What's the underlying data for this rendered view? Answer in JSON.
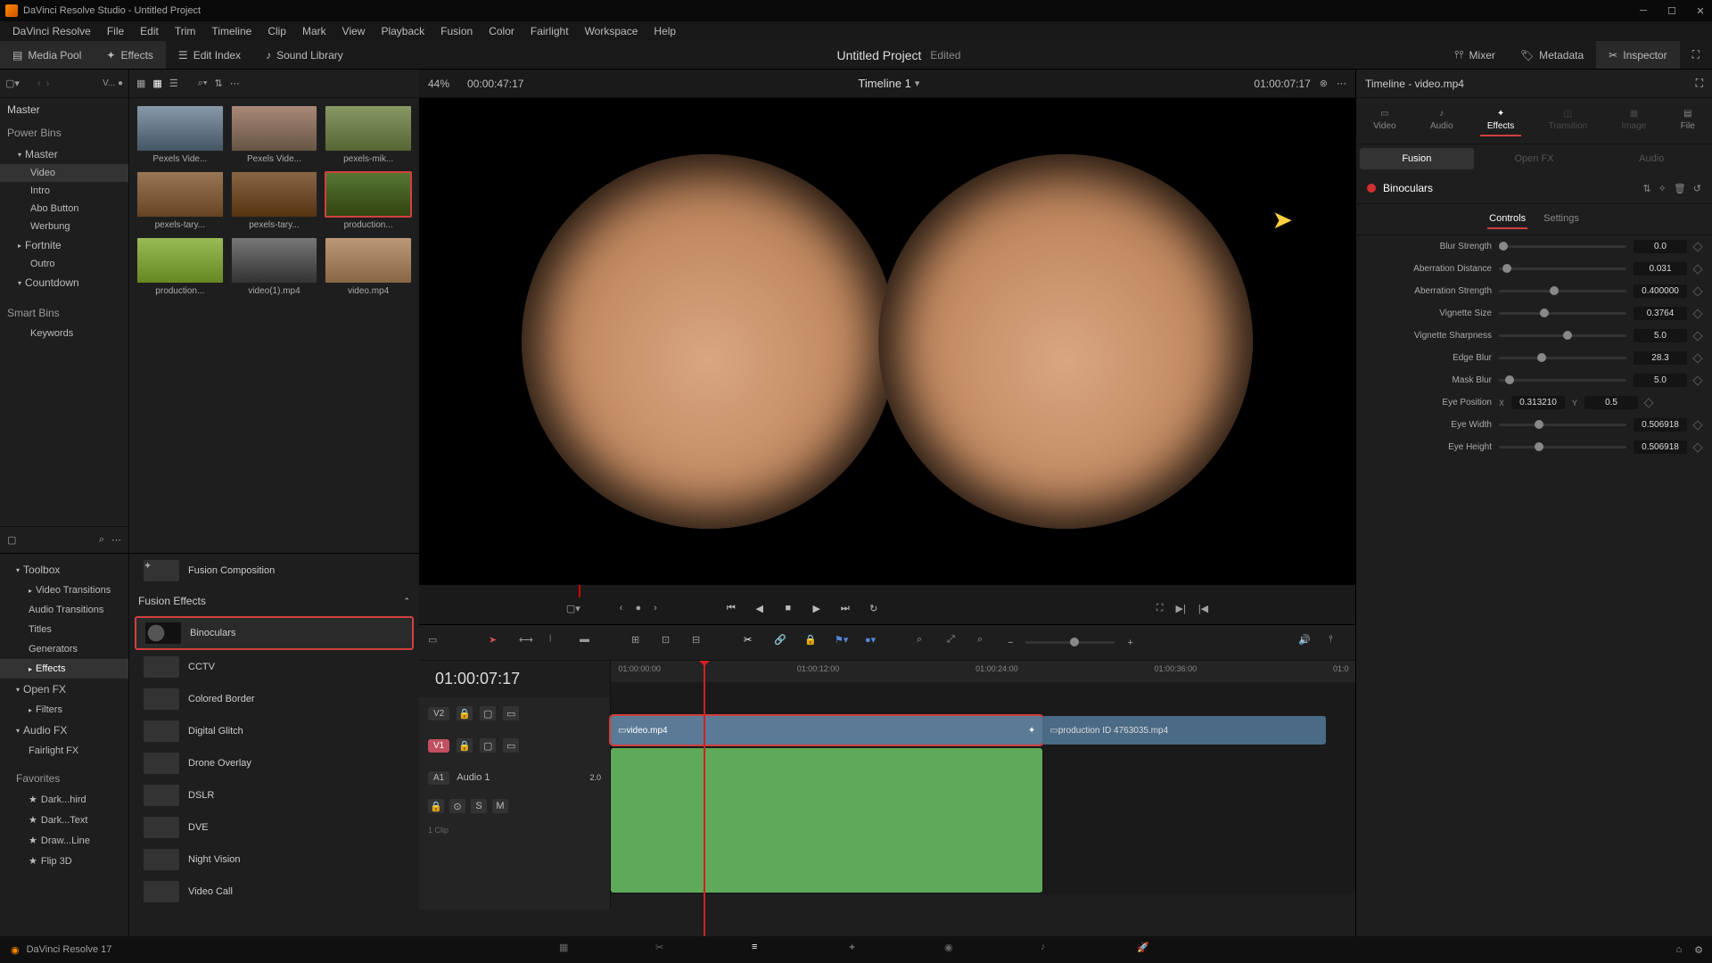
{
  "title": "DaVinci Resolve Studio - Untitled Project",
  "menus": [
    "DaVinci Resolve",
    "File",
    "Edit",
    "Trim",
    "Timeline",
    "Clip",
    "Mark",
    "View",
    "Playback",
    "Fusion",
    "Color",
    "Fairlight",
    "Workspace",
    "Help"
  ],
  "workspace": {
    "buttons": [
      "Media Pool",
      "Effects",
      "Edit Index",
      "Sound Library"
    ],
    "right": [
      "Mixer",
      "Metadata",
      "Inspector"
    ],
    "project": "Untitled Project",
    "edited": "Edited"
  },
  "bins": {
    "master": "Master",
    "power_header": "Power Bins",
    "items": [
      "Master",
      "Video",
      "Intro",
      "Abo Button",
      "Werbung",
      "Fortnite",
      "Outro",
      "Countdown"
    ],
    "smart_header": "Smart Bins",
    "smart_items": [
      "Keywords"
    ]
  },
  "clips": [
    {
      "name": "Pexels Vide..."
    },
    {
      "name": "Pexels Vide..."
    },
    {
      "name": "pexels-mik..."
    },
    {
      "name": "pexels-tary..."
    },
    {
      "name": "pexels-tary..."
    },
    {
      "name": "production..."
    },
    {
      "name": "production..."
    },
    {
      "name": "video(1).mp4"
    },
    {
      "name": "video.mp4"
    }
  ],
  "fx_tree": {
    "toolbox": "Toolbox",
    "items": [
      "Video Transitions",
      "Audio Transitions",
      "Titles",
      "Generators",
      "Effects"
    ],
    "openfx": "Open FX",
    "filters": "Filters",
    "audiofx": "Audio FX",
    "fairlight": "Fairlight FX",
    "fav": "Favorites",
    "favs": [
      "Dark...hird",
      "Dark...Text",
      "Draw...Line",
      "Flip 3D"
    ]
  },
  "fx_list": {
    "fusion_comp": "Fusion Composition",
    "header": "Fusion Effects",
    "items": [
      "Binoculars",
      "CCTV",
      "Colored Border",
      "Digital Glitch",
      "Drone Overlay",
      "DSLR",
      "DVE",
      "Night Vision",
      "Video Call"
    ]
  },
  "viewer": {
    "zoom": "44%",
    "idle_tc": "00:00:47:17",
    "title": "Timeline 1",
    "right_tc": "01:00:07:17"
  },
  "timeline": {
    "tc": "01:00:07:17",
    "ticks": [
      "01:00:00:00",
      "01:00:12:00",
      "01:00:24:00",
      "01:00:36:00",
      "01:0"
    ],
    "v2": "V2",
    "v1": "V1",
    "a1": "A1",
    "a1_name": "Audio 1",
    "a1_gain": "2.0",
    "a1_sub": "1 Clip",
    "clip1": "video.mp4",
    "clip2": "production ID 4763035.mp4"
  },
  "inspector": {
    "header": "Timeline - video.mp4",
    "tabs": [
      "Video",
      "Audio",
      "Effects",
      "Transition",
      "Image",
      "File"
    ],
    "subtabs": [
      "Fusion",
      "Open FX",
      "Audio"
    ],
    "fx_name": "Binoculars",
    "param_tabs": [
      "Controls",
      "Settings"
    ],
    "params": [
      {
        "label": "Blur Strength",
        "val": "0.0",
        "pos": 0
      },
      {
        "label": "Aberration Distance",
        "val": "0.031",
        "pos": 3
      },
      {
        "label": "Aberration Strength",
        "val": "0.400000",
        "pos": 40
      },
      {
        "label": "Vignette Size",
        "val": "0.3764",
        "pos": 32
      },
      {
        "label": "Vignette Sharpness",
        "val": "5.0",
        "pos": 50
      },
      {
        "label": "Edge Blur",
        "val": "28.3",
        "pos": 30
      },
      {
        "label": "Mask Blur",
        "val": "5.0",
        "pos": 5
      },
      {
        "label": "Eye Position",
        "val": "0.313210",
        "pos": 28,
        "xy": true,
        "yval": "0.5"
      },
      {
        "label": "Eye Width",
        "val": "0.506918",
        "pos": 28
      },
      {
        "label": "Eye Height",
        "val": "0.506918",
        "pos": 28
      }
    ]
  },
  "footer": "DaVinci Resolve 17"
}
